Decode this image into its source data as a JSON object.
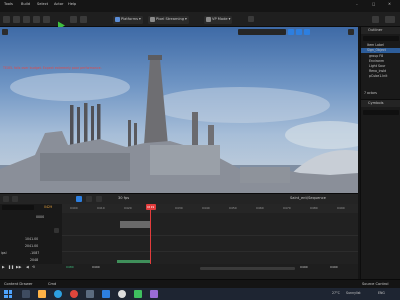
{
  "menu": {
    "items": [
      "Tools",
      "Build",
      "Select",
      "Actor",
      "Help"
    ]
  },
  "toolbar": {
    "platforms_label": "Platforms",
    "pixel_streaming_label": "Pixel Streaming",
    "vr_mode_label": "VP Mode"
  },
  "viewport": {
    "warning": "TEXEL falls over budget. Expect extremely poor performance."
  },
  "outliner": {
    "tab": "Outliner",
    "filter": "Item Label",
    "items": [
      "Sign_Object",
      "group F8",
      "Environm",
      "Light Sour",
      "Reno_insId",
      "pCube1.Init"
    ],
    "footer": "7 actors"
  },
  "details": {
    "tab": "Cymbols"
  },
  "sequencer": {
    "fps": "30 fps",
    "current_frame": "0429",
    "sequence_name": "Saint_ent/Sequence",
    "track_label": "ipsl",
    "ruler_ticks": [
      "0400",
      "0410",
      "0420",
      "0430",
      "0440",
      "0450",
      "0460",
      "0470",
      "0480",
      "0490",
      "0500"
    ],
    "left_values": [
      "0000",
      "1041.00",
      "2041.00",
      "-1087",
      "2048"
    ],
    "bottom_values": [
      "0480",
      "0490",
      "0490",
      "0490"
    ]
  },
  "statusbar": {
    "content_drawer": "Content Drawer",
    "cmd_label": "Cmd",
    "source_control": "Source Control"
  },
  "taskbar": {
    "temperature": "27°C",
    "weather": "Sunnylist",
    "tray": "ENG"
  },
  "colors": {
    "accent_blue": "#2d7fe0",
    "playhead_red": "#e23c3c",
    "warning_red": "#e04a4a",
    "panel_bg": "#1a1a1a"
  }
}
